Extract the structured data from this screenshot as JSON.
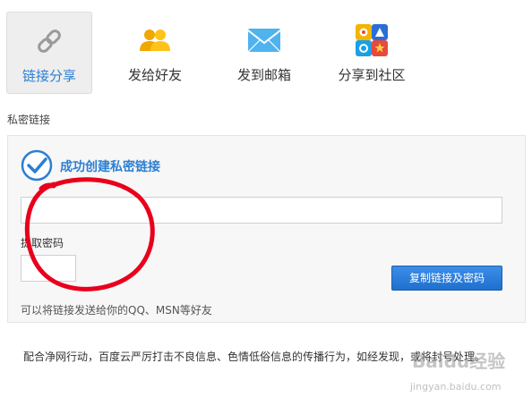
{
  "tabs": [
    {
      "label": "链接分享",
      "icon": "link-icon",
      "active": true
    },
    {
      "label": "发给好友",
      "icon": "friends-icon",
      "active": false
    },
    {
      "label": "发到邮箱",
      "icon": "mail-icon",
      "active": false
    },
    {
      "label": "分享到社区",
      "icon": "community-icon",
      "active": false
    }
  ],
  "section_title": "私密链接",
  "success_text": "成功创建私密链接",
  "link_value": "",
  "password_label": "提取密码",
  "password_value": "",
  "copy_button_label": "复制链接及密码",
  "hint_text": "可以将链接发送给你的QQ、MSN等好友",
  "footer_text": "配合净网行动，百度云严厉打击不良信息、色情低俗信息的传播行为，如经发现，或将封号处理。",
  "watermark": {
    "brand": "Baidu经验",
    "url": "jingyan.baidu.com"
  },
  "colors": {
    "accent": "#2c7fd2",
    "annotation": "#e8001c",
    "button": "#2a7bd8"
  }
}
